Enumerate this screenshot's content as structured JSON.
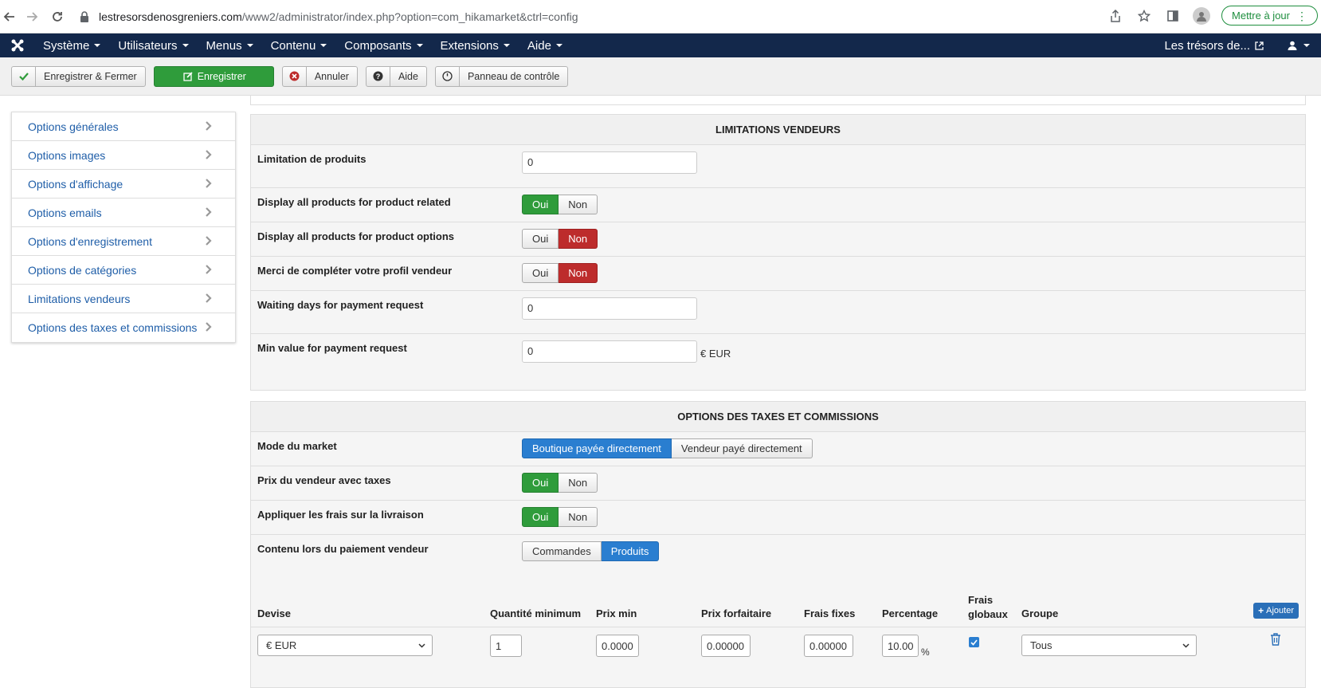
{
  "browser": {
    "url_host": "lestresorsdenosgreniers.com",
    "url_rest": "/www2/administrator/index.php?option=com_hikamarket&ctrl=config",
    "update_label": "Mettre à jour"
  },
  "navbar": {
    "menus": [
      "Système",
      "Utilisateurs",
      "Menus",
      "Contenu",
      "Composants",
      "Extensions",
      "Aide"
    ],
    "site_link": "Les trésors de..."
  },
  "toolbar": {
    "save_close": "Enregistrer & Fermer",
    "save": "Enregistrer",
    "cancel": "Annuler",
    "help": "Aide",
    "control_panel": "Panneau de contrôle"
  },
  "sidebar": {
    "items": [
      "Options générales",
      "Options images",
      "Options d'affichage",
      "Options emails",
      "Options d'enregistrement",
      "Options de catégories",
      "Limitations vendeurs",
      "Options des taxes et commissions"
    ]
  },
  "limits": {
    "title": "LIMITATIONS VENDEURS",
    "product_limit_label": "Limitation de produits",
    "product_limit_value": "0",
    "display_related_label": "Display all products for product related",
    "display_options_label": "Display all products for product options",
    "complete_profile_label": "Merci de compléter votre profil vendeur",
    "waiting_days_label": "Waiting days for payment request",
    "waiting_days_value": "0",
    "min_value_label": "Min value for payment request",
    "min_value_value": "0",
    "min_value_suffix": "€ EUR",
    "yes": "Oui",
    "no": "Non"
  },
  "taxes": {
    "title": "OPTIONS DES TAXES ET COMMISSIONS",
    "market_mode_label": "Mode du market",
    "mode_shop": "Boutique payée directement",
    "mode_vendor": "Vendeur payé directement",
    "vendor_price_tax_label": "Prix du vendeur avec taxes",
    "apply_fees_shipping_label": "Appliquer les frais sur la livraison",
    "payment_content_label": "Contenu lors du paiement vendeur",
    "content_orders": "Commandes",
    "content_products": "Produits",
    "yes": "Oui",
    "no": "Non"
  },
  "commission_table": {
    "headers": {
      "currency": "Devise",
      "min_qty": "Quantité minimum",
      "min_price": "Prix min",
      "flat_price": "Prix forfaitaire",
      "fixed_fees": "Frais fixes",
      "percentage": "Percentage",
      "global_fees_1": "Frais",
      "global_fees_2": "globaux",
      "group": "Groupe"
    },
    "add_label": "Ajouter",
    "row": {
      "currency": "€ EUR",
      "min_qty": "1",
      "min_price": "0.0000",
      "flat_price": "0.00000",
      "fixed_fees": "0.00000",
      "percentage": "10.00",
      "percent_sign": "%",
      "global_fees_checked": true,
      "group": "Tous"
    }
  },
  "colors": {
    "navbar": "#13284b",
    "green": "#2f9c3b",
    "red": "#bd2c2c",
    "blue": "#2a7ed0",
    "link": "#1f5ea8"
  }
}
